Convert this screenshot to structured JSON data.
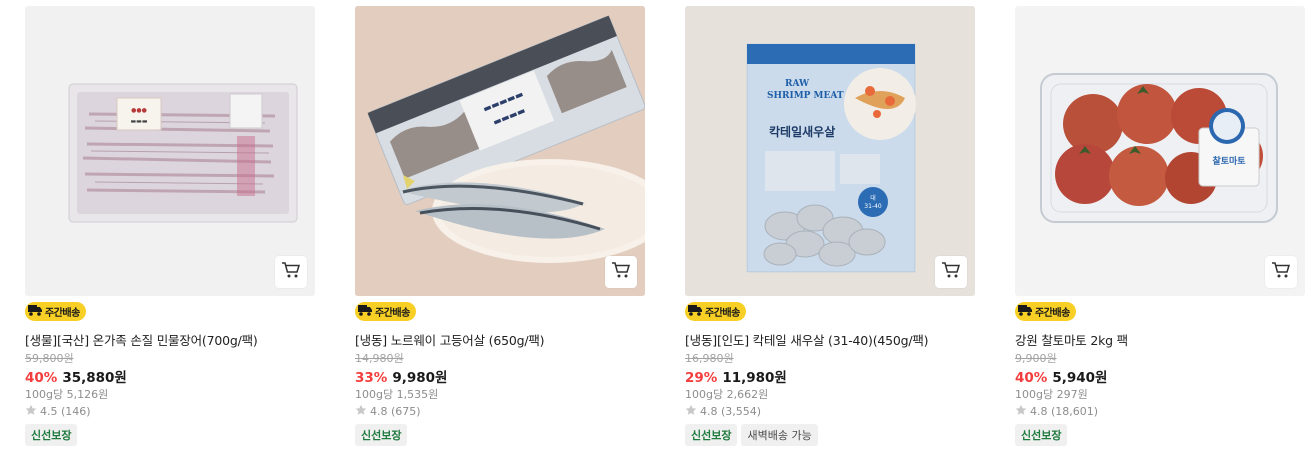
{
  "products": [
    {
      "badge": "주간배송",
      "name": "[생물][국산] 온가족 손질 민물장어(700g/팩)",
      "original_price": "59,800원",
      "discount_rate": "40%",
      "price": "35,880원",
      "unit_price": "100g당 5,126원",
      "rating": "4.5 (146)",
      "tags": [
        "신선보장"
      ]
    },
    {
      "badge": "주간배송",
      "name": "[냉동] 노르웨이 고등어살 (650g/팩)",
      "original_price": "14,980원",
      "discount_rate": "33%",
      "price": "9,980원",
      "unit_price": "100g당 1,535원",
      "rating": "4.8 (675)",
      "tags": [
        "신선보장"
      ]
    },
    {
      "badge": "주간배송",
      "name": "[냉동][인도] 칵테일 새우살 (31-40)(450g/팩)",
      "original_price": "16,980원",
      "discount_rate": "29%",
      "price": "11,980원",
      "unit_price": "100g당 2,662원",
      "rating": "4.8 (3,554)",
      "tags": [
        "신선보장",
        "새벽배송 가능"
      ],
      "package_text": {
        "line1": "RAW",
        "line2": "SHRIMP MEAT",
        "korean": "칵테일새우살",
        "size": "31-40"
      }
    },
    {
      "badge": "주간배송",
      "name": "강원 찰토마토 2kg 팩",
      "original_price": "9,900원",
      "discount_rate": "40%",
      "price": "5,940원",
      "unit_price": "100g당 297원",
      "rating": "4.8 (18,601)",
      "tags": [
        "신선보장"
      ],
      "label_text": "찰토마토"
    }
  ],
  "icons": {
    "cart": "cart-icon",
    "badge_truck": "delivery-truck-icon",
    "star": "star-icon"
  },
  "colors": {
    "badge_bg": "#f8cf24",
    "discount": "#f43d3d",
    "fresh_tag": "#1f7a3e",
    "star": "#c8c8c8"
  }
}
